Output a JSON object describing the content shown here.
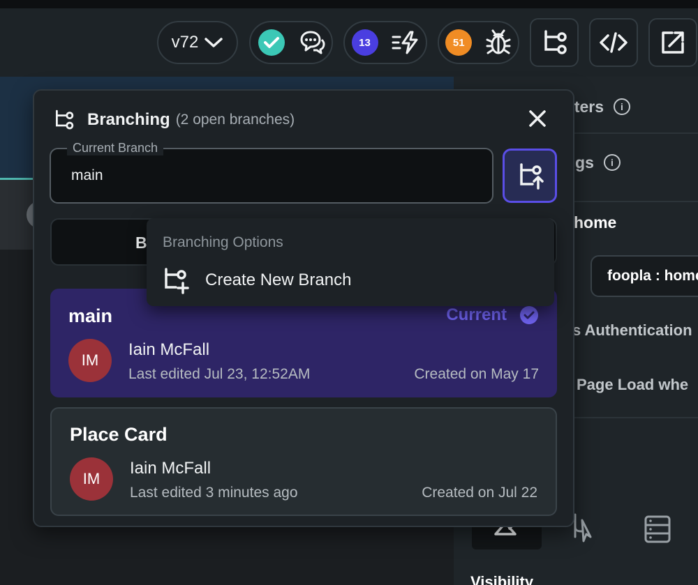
{
  "toolbar": {
    "version_label": "v72",
    "publish_badge_count": "13",
    "bugs_badge_count": "51",
    "colors": {
      "check": "#3bc8b6",
      "publish_badge": "#4a3ee0",
      "bugs_badge": "#f08c24"
    }
  },
  "right_panel": {
    "params_label": "eters",
    "settings_label": "ngs",
    "route_label": "home",
    "route_select_value": "foopla : home",
    "auth_label": "s Authentication",
    "page_load_label": "Page Load whe",
    "visibility_label": "Visibility"
  },
  "branching": {
    "title": "Branching",
    "subtitle": "(2 open branches)",
    "current_branch_legend": "Current Branch",
    "current_branch_value": "main",
    "behind_button_label": "B",
    "options_header": "Branching Options",
    "create_new_branch_label": "Create New Branch",
    "branches": [
      {
        "name": "main",
        "status": "Current",
        "avatar_initials": "IM",
        "user": "Iain McFall",
        "last_edited": "Last edited Jul 23, 12:52AM",
        "created": "Created on May 17"
      },
      {
        "name": "Place Card",
        "avatar_initials": "IM",
        "user": "Iain McFall",
        "last_edited": "Last edited 3 minutes ago",
        "created": "Created on Jul 22"
      }
    ]
  }
}
